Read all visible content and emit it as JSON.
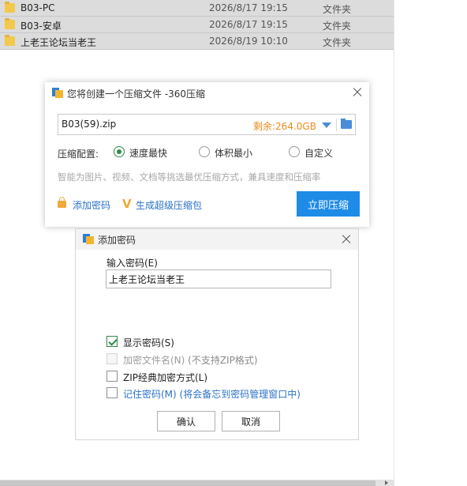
{
  "file_list": {
    "rows": [
      {
        "name": "B03-PC",
        "date": "2026/8/17 19:15",
        "type": "文件夹"
      },
      {
        "name": "B03-安卓",
        "date": "2026/8/17 19:15",
        "type": "文件夹"
      },
      {
        "name": "上老王论坛当老王",
        "date": "2026/8/19 10:10",
        "type": "文件夹"
      }
    ]
  },
  "compress_dialog": {
    "title": "您将创建一个压缩文件 -360压缩",
    "filename": "B03(59).zip",
    "free_space": "剩余:264.0GB",
    "config_label": "压缩配置:",
    "options": [
      {
        "label": "速度最快",
        "checked": true
      },
      {
        "label": "体积最小",
        "checked": false
      },
      {
        "label": "自定义",
        "checked": false
      }
    ],
    "hint": "智能为图片、视频、文档等挑选最优压缩方式，兼具速度和压缩率",
    "add_password": "添加密码",
    "super_package": "生成超级压缩包",
    "compress_button": "立即压缩",
    "accent_color": "#1e8be6"
  },
  "password_dialog": {
    "title": "添加密码",
    "input_label": "输入密码(E)",
    "password_value": "上老王论坛当老王",
    "show_password": {
      "label": "显示密码(S)",
      "checked": true
    },
    "encrypt_filenames": {
      "label": "加密文件名(N)",
      "note": " (不支持ZIP格式)",
      "disabled": true
    },
    "zip_classic": {
      "label": "ZIP经典加密方式(L)",
      "checked": false
    },
    "remember_password": {
      "label": "记住密码(M)",
      "note": " (将会备忘到密码管理窗口中)",
      "checked": false
    },
    "ok_button": "确认",
    "cancel_button": "取消"
  }
}
